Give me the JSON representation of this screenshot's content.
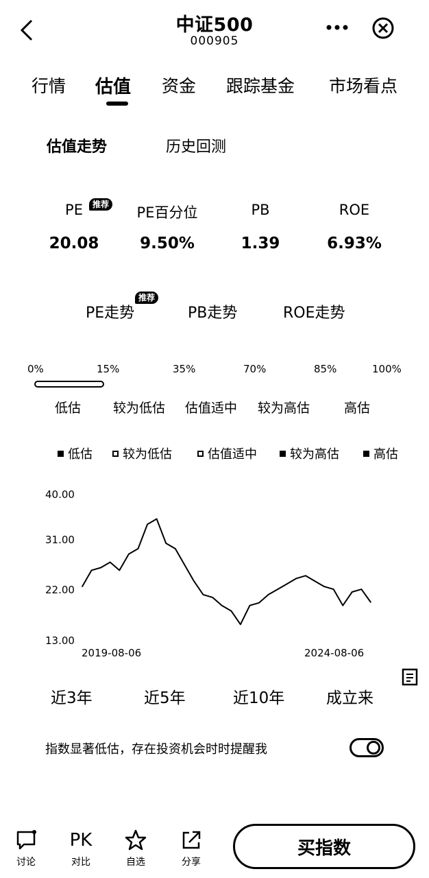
{
  "header": {
    "title": "中证500",
    "code": "000905"
  },
  "tabs": [
    {
      "label": "行情"
    },
    {
      "label": "估值"
    },
    {
      "label": "资金"
    },
    {
      "label": "跟踪基金"
    },
    {
      "label": "市场看点"
    }
  ],
  "subtabs": [
    {
      "label": "估值走势"
    },
    {
      "label": "历史回测"
    }
  ],
  "metrics": [
    {
      "label": "PE",
      "value": "20.08",
      "badge": "推荐"
    },
    {
      "label": "PE百分位",
      "value": "9.50%"
    },
    {
      "label": "PB",
      "value": "1.39"
    },
    {
      "label": "ROE",
      "value": "6.93%"
    }
  ],
  "trends": [
    {
      "label": "PE走势",
      "badge": "推荐"
    },
    {
      "label": "PB走势"
    },
    {
      "label": "ROE走势"
    }
  ],
  "scale": {
    "ticks": [
      "0%",
      "15%",
      "35%",
      "70%",
      "85%",
      "100%"
    ],
    "current_percentile": 0.095,
    "levels": [
      "低估",
      "较为低估",
      "估值适中",
      "较为高估",
      "高估"
    ]
  },
  "legend": [
    "低估",
    "较为低估",
    "估值适中",
    "较为高估",
    "高估"
  ],
  "chart_data": {
    "type": "line",
    "title": "",
    "xlabel": "",
    "ylabel": "",
    "ylim": [
      13,
      40
    ],
    "y_ticks": [
      "40.00",
      "31.00",
      "22.00",
      "13.00"
    ],
    "x_tick_labels": [
      "2019-08-06",
      "2024-08-06"
    ],
    "series": [
      {
        "x": [
          "2019-08",
          "2019-10",
          "2019-12",
          "2020-02",
          "2020-04",
          "2020-06",
          "2020-07",
          "2020-08",
          "2020-10",
          "2020-12",
          "2021-02",
          "2021-04",
          "2021-06",
          "2021-08",
          "2021-10",
          "2021-12",
          "2022-02",
          "2022-04",
          "2022-06",
          "2022-08",
          "2022-10",
          "2022-12",
          "2023-02",
          "2023-04",
          "2023-06",
          "2023-08",
          "2023-10",
          "2023-12",
          "2024-02",
          "2024-04",
          "2024-06",
          "2024-08"
        ],
        "values": [
          23.0,
          26.0,
          26.5,
          27.5,
          26.0,
          29.0,
          30.0,
          34.5,
          35.5,
          31.0,
          30.0,
          27.0,
          24.0,
          21.5,
          21.0,
          19.5,
          18.5,
          16.0,
          19.5,
          20.0,
          21.5,
          22.5,
          23.5,
          24.5,
          25.0,
          24.0,
          23.0,
          22.5,
          19.5,
          22.0,
          22.5,
          20.1
        ]
      }
    ]
  },
  "actions": {
    "period_buttons": [
      "近3年",
      "近5年",
      "近10年",
      "成立来"
    ],
    "remind_text": "指数显著低估，存在投资机会时时提醒我"
  },
  "bottom_bar": [
    {
      "label": "讨论",
      "icon": "comment-icon"
    },
    {
      "label": "对比",
      "icon_text": "PK"
    },
    {
      "label": "自选",
      "icon": "star-icon"
    },
    {
      "label": "分享",
      "icon": "share-icon"
    }
  ],
  "buy_button": "买指数"
}
